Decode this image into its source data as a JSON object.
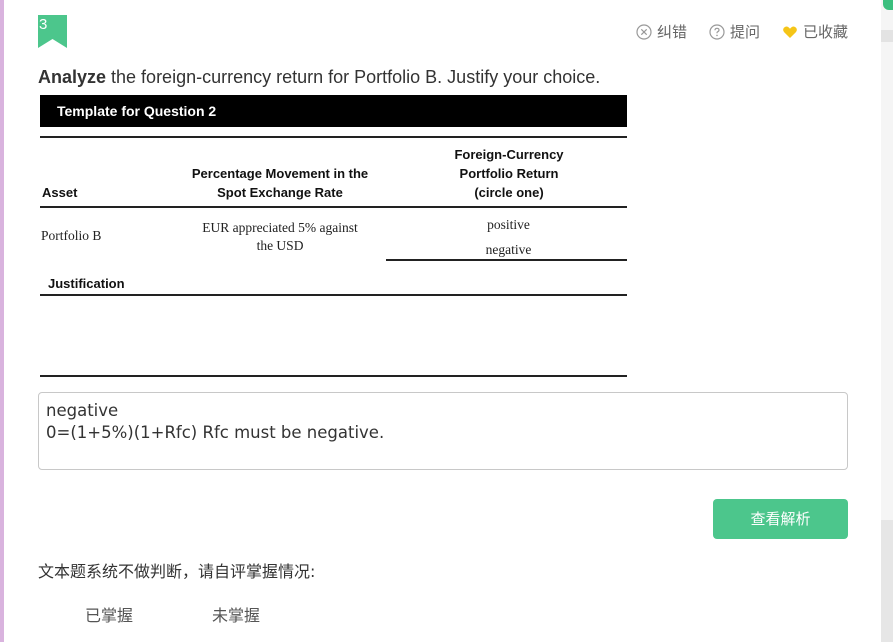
{
  "question_number": "3",
  "toolbar": {
    "report_error": "纠错",
    "ask": "提问",
    "favorited": "已收藏"
  },
  "question": {
    "bold_word": "Analyze",
    "rest": " the foreign-currency return for Portfolio B. Justify your choice."
  },
  "template": {
    "title": "Template for Question 2",
    "col_asset": "Asset",
    "col_movement_line1": "Percentage Movement in the",
    "col_movement_line2": "Spot Exchange Rate",
    "col_return_line1": "Foreign-Currency",
    "col_return_line2": "Portfolio Return",
    "col_return_line3": "(circle one)",
    "row_asset": "Portfolio B",
    "row_movement_line1": "EUR appreciated 5% against",
    "row_movement_line2": "the USD",
    "option_positive": "positive",
    "option_negative": "negative",
    "justification_label": "Justification"
  },
  "answer": {
    "line1": "negative",
    "line2": "0=(1+5%)(1+Rfc) Rfc must be negative."
  },
  "buttons": {
    "view_analysis": "查看解析"
  },
  "note": "文本题系统不做判断，请自评掌握情况:",
  "mastery": {
    "mastered": "已掌握",
    "not_mastered": "未掌握"
  },
  "colors": {
    "accent_green": "#4cc68c",
    "heart_yellow": "#f5c518",
    "left_bar": "#d9b3de"
  }
}
